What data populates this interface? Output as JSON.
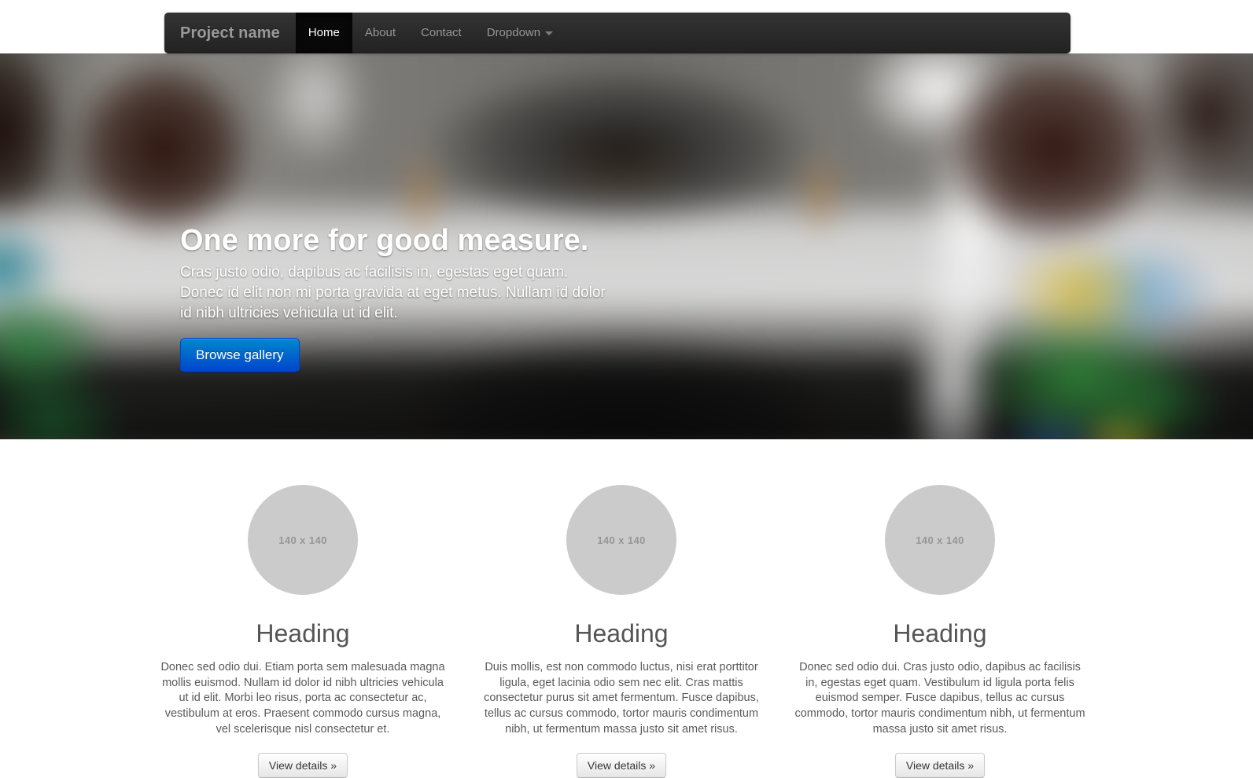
{
  "navbar": {
    "brand": "Project name",
    "items": [
      {
        "label": "Home",
        "active": true,
        "caret": false
      },
      {
        "label": "About",
        "active": false,
        "caret": false
      },
      {
        "label": "Contact",
        "active": false,
        "caret": false
      },
      {
        "label": "Dropdown",
        "active": false,
        "caret": true
      }
    ],
    "background_color": "#222222",
    "active_background_color": "#080808",
    "text_color": "#999999",
    "active_text_color": "#ffffff"
  },
  "hero": {
    "title": "One more for good measure.",
    "lead": "Cras justo odio, dapibus ac facilisis in, egestas eget quam. Donec id elit non mi porta gravida at eget metus. Nullam id dolor id nibh ultricies vehicula ut id elit.",
    "button_label": "Browse gallery",
    "button_color": "#006dcc",
    "background_description": "blurred-interior-shelf-photo"
  },
  "marketing": {
    "columns": [
      {
        "image_placeholder": "140 x 140",
        "heading": "Heading",
        "body": "Donec sed odio dui. Etiam porta sem malesuada magna mollis euismod. Nullam id dolor id nibh ultricies vehicula ut id elit. Morbi leo risus, porta ac consectetur ac, vestibulum at eros. Praesent commodo cursus magna, vel scelerisque nisl consectetur et.",
        "button_label": "View details »"
      },
      {
        "image_placeholder": "140 x 140",
        "heading": "Heading",
        "body": "Duis mollis, est non commodo luctus, nisi erat porttitor ligula, eget lacinia odio sem nec elit. Cras mattis consectetur purus sit amet fermentum. Fusce dapibus, tellus ac cursus commodo, tortor mauris condimentum nibh, ut fermentum massa justo sit amet risus.",
        "button_label": "View details »"
      },
      {
        "image_placeholder": "140 x 140",
        "heading": "Heading",
        "body": "Donec sed odio dui. Cras justo odio, dapibus ac facilisis in, egestas eget quam. Vestibulum id ligula porta felis euismod semper. Fusce dapibus, tellus ac cursus commodo, tortor mauris condimentum nibh, ut fermentum massa justo sit amet risus.",
        "button_label": "View details »"
      }
    ],
    "placeholder_color": "#cbcbcb",
    "heading_color": "#555555"
  }
}
